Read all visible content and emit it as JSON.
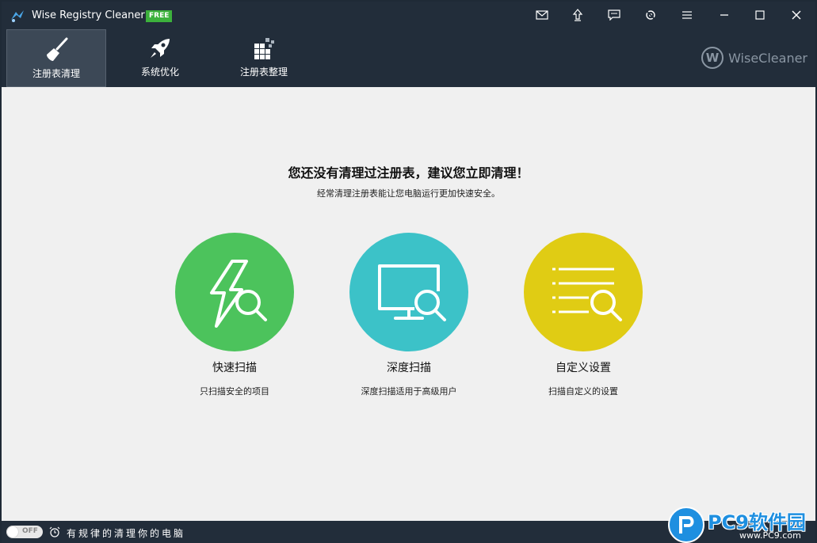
{
  "window": {
    "title": "Wise Registry Cleaner X",
    "badge": "FREE"
  },
  "titlebar_icons": [
    "mail-icon",
    "upload-icon",
    "feedback-icon",
    "settings-icon",
    "menu-icon",
    "minimize-icon",
    "maximize-icon",
    "close-icon"
  ],
  "toolbar": {
    "tabs": [
      {
        "label": "注册表清理",
        "icon": "broom-icon",
        "active": true
      },
      {
        "label": "系统优化",
        "icon": "rocket-icon",
        "active": false
      },
      {
        "label": "注册表整理",
        "icon": "blocks-icon",
        "active": false
      }
    ],
    "brand": {
      "mark": "W",
      "name": "WiseCleaner"
    }
  },
  "main": {
    "headline": "您还没有清理过注册表，建议您立即清理！",
    "subline": "经常清理注册表能让您电脑运行更加快速安全。",
    "scans": [
      {
        "title": "快速扫描",
        "desc": "只扫描安全的项目",
        "color": "#4cc35c",
        "icon": "lightning-search-icon"
      },
      {
        "title": "深度扫描",
        "desc": "深度扫描适用于高级用户",
        "color": "#3cc2c8",
        "icon": "monitor-search-icon"
      },
      {
        "title": "自定义设置",
        "desc": "扫描自定义的设置",
        "color": "#e0cc14",
        "icon": "list-search-icon"
      }
    ]
  },
  "statusbar": {
    "toggle_label": "OFF",
    "schedule_text": "有规律的清理你的电脑"
  },
  "watermark": {
    "name": "PC9软件园",
    "url": "www.PC9.com"
  },
  "colors": {
    "titlebar": "#222d3a",
    "active_tab": "#3c4856",
    "content_bg": "#f0f0f0",
    "badge": "#3cb13c"
  }
}
